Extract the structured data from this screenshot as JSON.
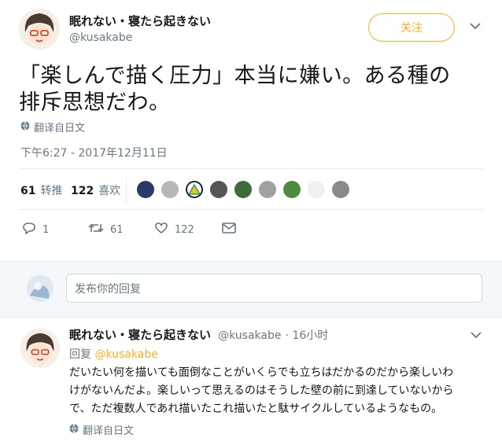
{
  "tweet": {
    "author_name": "眠れない・寝たら起きない",
    "author_handle": "@kusakabe",
    "follow_label": "关注",
    "text_line1": "「楽しんで描く圧力」本当に嫌い。ある種の",
    "text_line2": "排斥思想だわ。",
    "translate_label": "翻译自日文",
    "timestamp": "下午6:27 - 2017年12月11日",
    "retweets_count": "61",
    "retweets_label": "转推",
    "likes_count": "122",
    "likes_label": "喜欢",
    "actions": {
      "reply_count": "1",
      "retweet_count": "61",
      "like_count": "122"
    }
  },
  "compose": {
    "placeholder": "发布你的回复"
  },
  "reply": {
    "author_name": "眠れない・寝たら起きない",
    "author_handle": "@kusakabe",
    "time": "· 16小时",
    "replying_prefix": "回复",
    "replying_to": "@kusakabe",
    "line1": "だいたい何を描いても面倒なことがいくらでも立ちはだかるのだから楽しいわ",
    "line2": "けがないんだよ。楽しいって思えるのはそうした壁の前に到達していないから",
    "line3": "で、ただ複数人であれ描いたこれ描いたと駄サイクルしているようなもの。",
    "translate_label": "翻译自日文"
  },
  "colors": {
    "accent": "#ffad1f",
    "muted": "#657786",
    "divider": "#e6ecf0",
    "band": "#f5f8fa"
  }
}
